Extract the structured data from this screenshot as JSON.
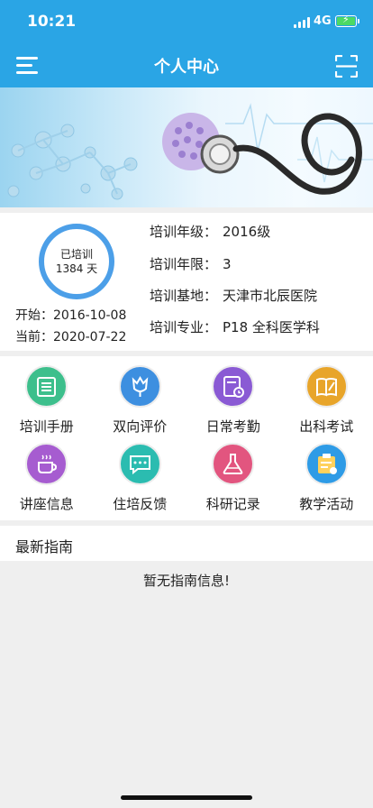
{
  "status_bar": {
    "time": "10:21",
    "network": "4G"
  },
  "nav": {
    "title": "个人中心",
    "menu_icon": "menu-icon",
    "scan_icon": "scan-icon"
  },
  "progress": {
    "line1": "已培训",
    "line2": "1384 天"
  },
  "dates": {
    "start_label": "开始：",
    "start_value": "2016-10-08",
    "current_label": "当前：",
    "current_value": "2020-07-22"
  },
  "training": [
    {
      "label": "培训年级：",
      "value": "2016级"
    },
    {
      "label": "培训年限：",
      "value": "3"
    },
    {
      "label": "培训基地：",
      "value": "天津市北辰医院"
    },
    {
      "label": "培训专业：",
      "value": "P18 全科医学科"
    }
  ],
  "menu": [
    {
      "label": "培训手册",
      "icon": "handbook-icon",
      "color": "#3dbf8c"
    },
    {
      "label": "双向评价",
      "icon": "evaluation-icon",
      "color": "#3d8fe0"
    },
    {
      "label": "日常考勤",
      "icon": "attendance-icon",
      "color": "#8a5ad4"
    },
    {
      "label": "出科考试",
      "icon": "exam-icon",
      "color": "#e8a52a"
    },
    {
      "label": "讲座信息",
      "icon": "lecture-icon",
      "color": "#a65cd0"
    },
    {
      "label": "住培反馈",
      "icon": "feedback-icon",
      "color": "#2bbcb0"
    },
    {
      "label": "科研记录",
      "icon": "research-icon",
      "color": "#e2557f"
    },
    {
      "label": "教学活动",
      "icon": "teaching-icon",
      "color": "#2e9be6"
    }
  ],
  "guide": {
    "header": "最新指南",
    "empty_text": "暂无指南信息!"
  },
  "colors": {
    "header_blue": "#2aa5e5",
    "ring_blue": "#4c9fe8"
  }
}
